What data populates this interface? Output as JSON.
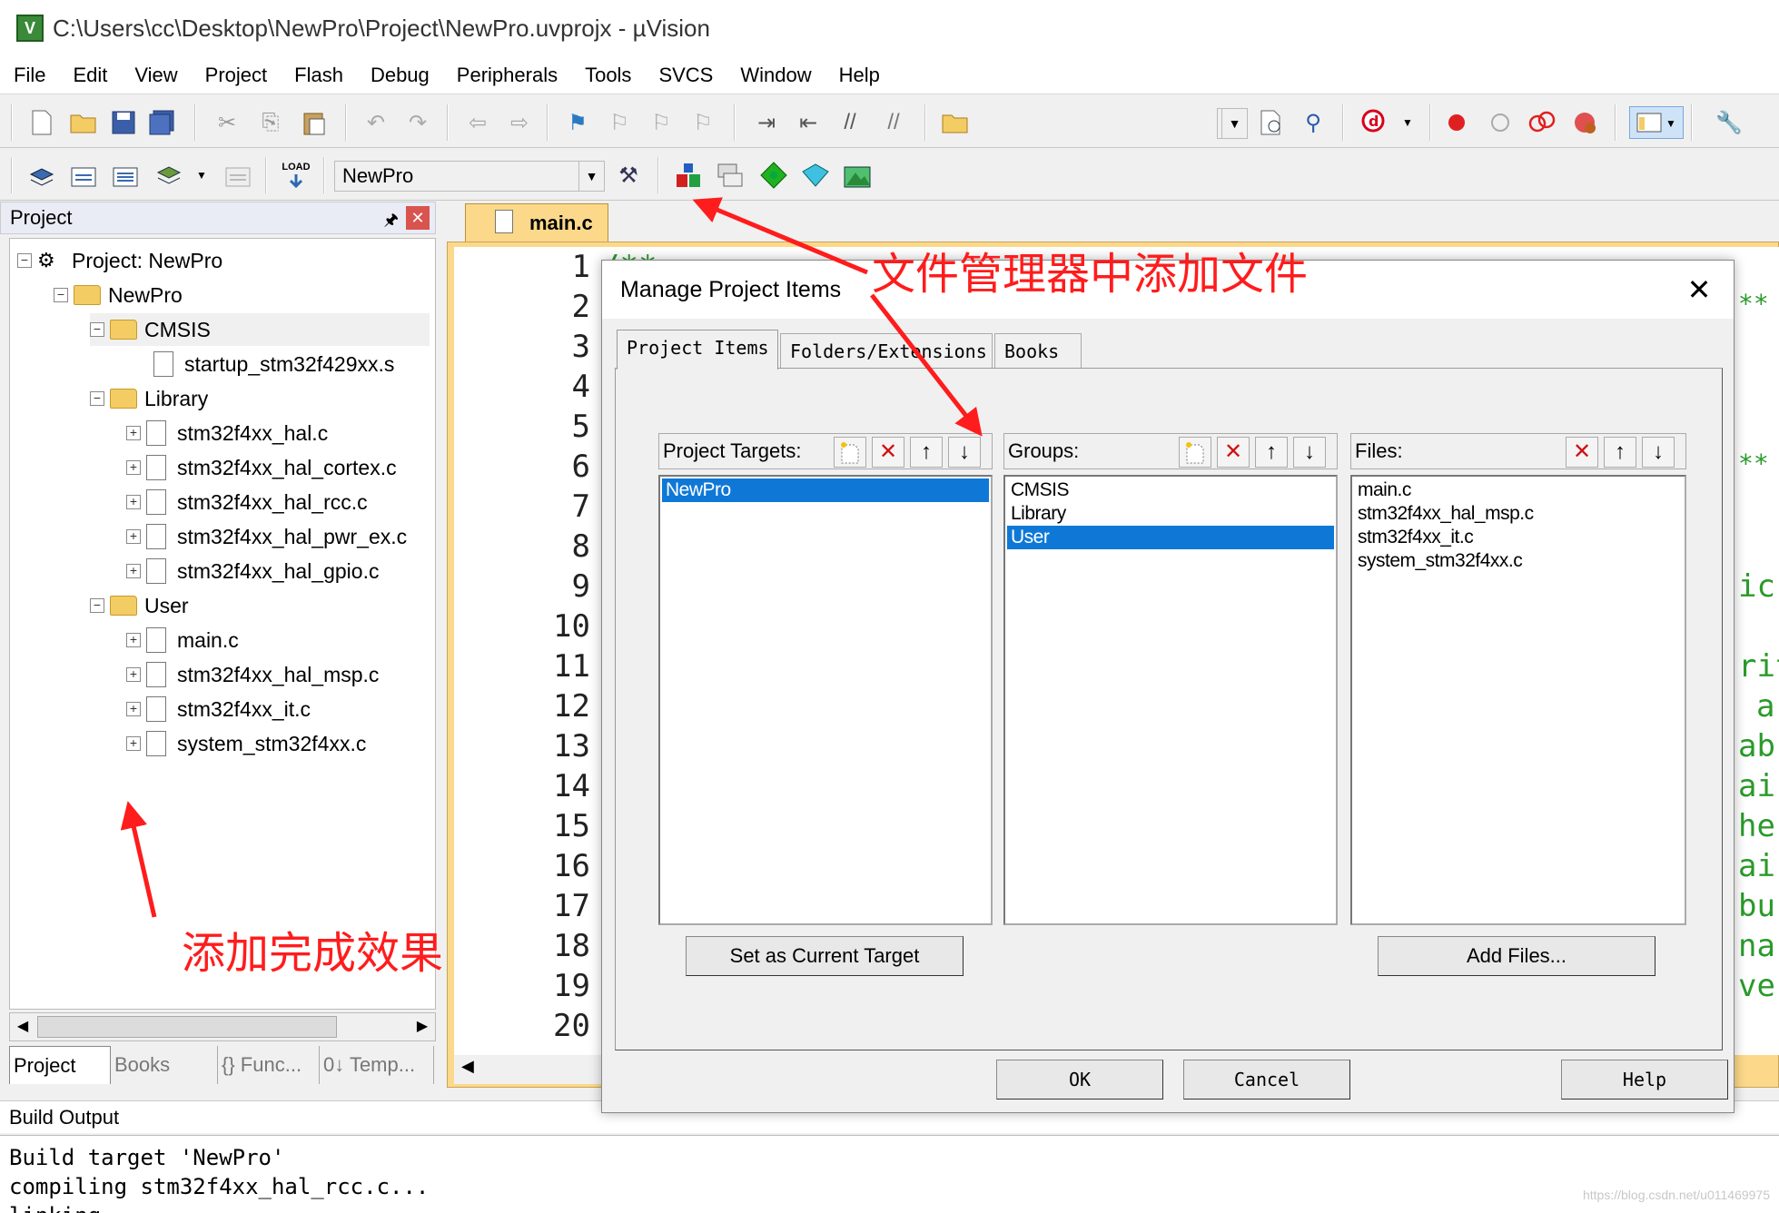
{
  "window": {
    "title": "C:\\Users\\cc\\Desktop\\NewPro\\Project\\NewPro.uvprojx - µVision",
    "app_icon_letter": "V"
  },
  "menu": [
    "File",
    "Edit",
    "View",
    "Project",
    "Flash",
    "Debug",
    "Peripherals",
    "Tools",
    "SVCS",
    "Window",
    "Help"
  ],
  "toolbar2": {
    "target_select": "NewPro",
    "load_label": "LOAD"
  },
  "project_panel": {
    "header": "Project",
    "tree": {
      "root": "Project: NewPro",
      "target": "NewPro",
      "groups": [
        {
          "name": "CMSIS",
          "files": [
            "startup_stm32f429xx.s"
          ]
        },
        {
          "name": "Library",
          "files": [
            "stm32f4xx_hal.c",
            "stm32f4xx_hal_cortex.c",
            "stm32f4xx_hal_rcc.c",
            "stm32f4xx_hal_pwr_ex.c",
            "stm32f4xx_hal_gpio.c"
          ]
        },
        {
          "name": "User",
          "files": [
            "main.c",
            "stm32f4xx_hal_msp.c",
            "stm32f4xx_it.c",
            "system_stm32f4xx.c"
          ]
        }
      ]
    },
    "tabs": [
      "Project",
      "Books",
      "{} Func...",
      "0↓ Temp..."
    ]
  },
  "editor": {
    "tab": "main.c",
    "line_numbers": [
      "1",
      "2",
      "3",
      "4",
      "5",
      "6",
      "7",
      "8",
      "9",
      "10",
      "11",
      "12",
      "13",
      "14",
      "15",
      "16",
      "17",
      "18",
      "19",
      "20"
    ],
    "visible_fragments": [
      "/**",
      "**",
      "**",
      "ic",
      "rit",
      "a",
      "ab",
      "ai",
      "he",
      "ai",
      "bu",
      "na",
      "ve"
    ]
  },
  "build_output": {
    "header": "Build Output",
    "lines": [
      "Build target 'NewPro'",
      "compiling stm32f4xx_hal_rcc.c...",
      "linking..."
    ]
  },
  "watermark": "https://blog.csdn.net/u011469975",
  "dialog": {
    "title": "Manage Project Items",
    "tabs": [
      "Project Items",
      "Folders/Extensions",
      "Books"
    ],
    "targets": {
      "label": "Project Targets:",
      "items": [
        "NewPro"
      ],
      "selected": 0
    },
    "groups": {
      "label": "Groups:",
      "items": [
        "CMSIS",
        "Library",
        "User"
      ],
      "selected": 2
    },
    "files": {
      "label": "Files:",
      "items": [
        "main.c",
        "stm32f4xx_hal_msp.c",
        "stm32f4xx_it.c",
        "system_stm32f4xx.c"
      ]
    },
    "set_target_button": "Set as Current Target",
    "add_files_button": "Add Files...",
    "ok": "OK",
    "cancel": "Cancel",
    "help": "Help"
  },
  "annotations": {
    "top": "文件管理器中添加文件",
    "bottom": "添加完成效果",
    "color": "#ff1c1c"
  },
  "colors": {
    "selection": "#0f78d7",
    "editor_tab": "#fcd98a",
    "code_comment": "#2a9a2a",
    "close_button": "#d9534f"
  }
}
